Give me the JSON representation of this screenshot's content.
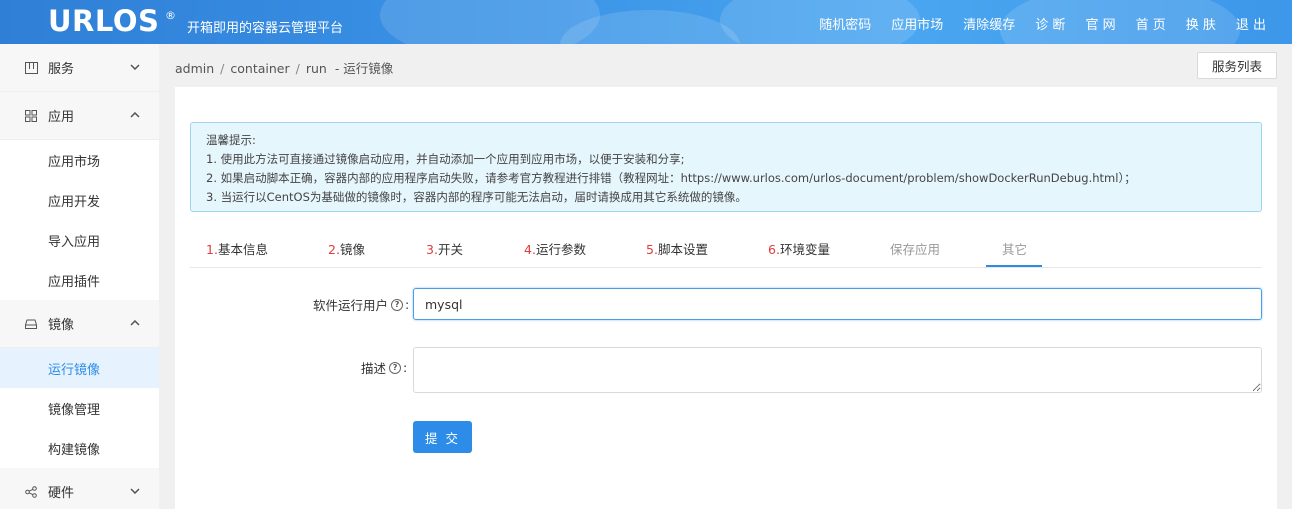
{
  "header": {
    "logo": "URLOS",
    "logo_mark": "®",
    "slogan": "开箱即用的容器云管理平台",
    "nav": [
      "随机密码",
      "应用市场",
      "清除缓存",
      "诊 断",
      "官 网",
      "首 页",
      "换 肤",
      "退 出"
    ]
  },
  "sidebar": {
    "groups": [
      {
        "label": "服务",
        "icon": "service-icon",
        "expanded": false,
        "items": []
      },
      {
        "label": "应用",
        "icon": "grid-icon",
        "expanded": true,
        "items": [
          "应用市场",
          "应用开发",
          "导入应用",
          "应用插件"
        ]
      },
      {
        "label": "镜像",
        "icon": "drive-icon",
        "expanded": true,
        "items": [
          "运行镜像",
          "镜像管理",
          "构建镜像"
        ],
        "active": "运行镜像"
      },
      {
        "label": "硬件",
        "icon": "share-icon",
        "expanded": false,
        "items": []
      }
    ]
  },
  "breadcrumb": {
    "parts": [
      "admin",
      "container",
      "run"
    ],
    "suffix": "- 运行镜像"
  },
  "service_list_button": "服务列表",
  "tip": {
    "lines": [
      "温馨提示:",
      "1. 使用此方法可直接通过镜像启动应用，并自动添加一个应用到应用市场，以便于安装和分享;",
      "2. 如果启动脚本正确，容器内部的应用程序启动失败，请参考官方教程进行排错（教程网址：https://www.urlos.com/urlos-document/problem/showDockerRunDebug.html）；",
      "3. 当运行以CentOS为基础做的镜像时，容器内部的程序可能无法启动，届时请换成用其它系统做的镜像。"
    ]
  },
  "tabs": [
    {
      "num": "1.",
      "label": "基本信息"
    },
    {
      "num": "2.",
      "label": "镜像"
    },
    {
      "num": "3.",
      "label": "开关"
    },
    {
      "num": "4.",
      "label": "运行参数"
    },
    {
      "num": "5.",
      "label": "脚本设置"
    },
    {
      "num": "6.",
      "label": "环境变量"
    },
    {
      "num": "",
      "label": "保存应用"
    },
    {
      "num": "",
      "label": "其它"
    }
  ],
  "active_tab": "其它",
  "form": {
    "run_user_label": "软件运行用户",
    "run_user_value": "mysql",
    "desc_label": "描述",
    "colon": ":",
    "help_glyph": "?",
    "submit_label": "提 交"
  },
  "colors": {
    "accent": "#2d8ce8",
    "tab_number": "#e23c3c",
    "tip_bg": "#e6f6fd"
  }
}
